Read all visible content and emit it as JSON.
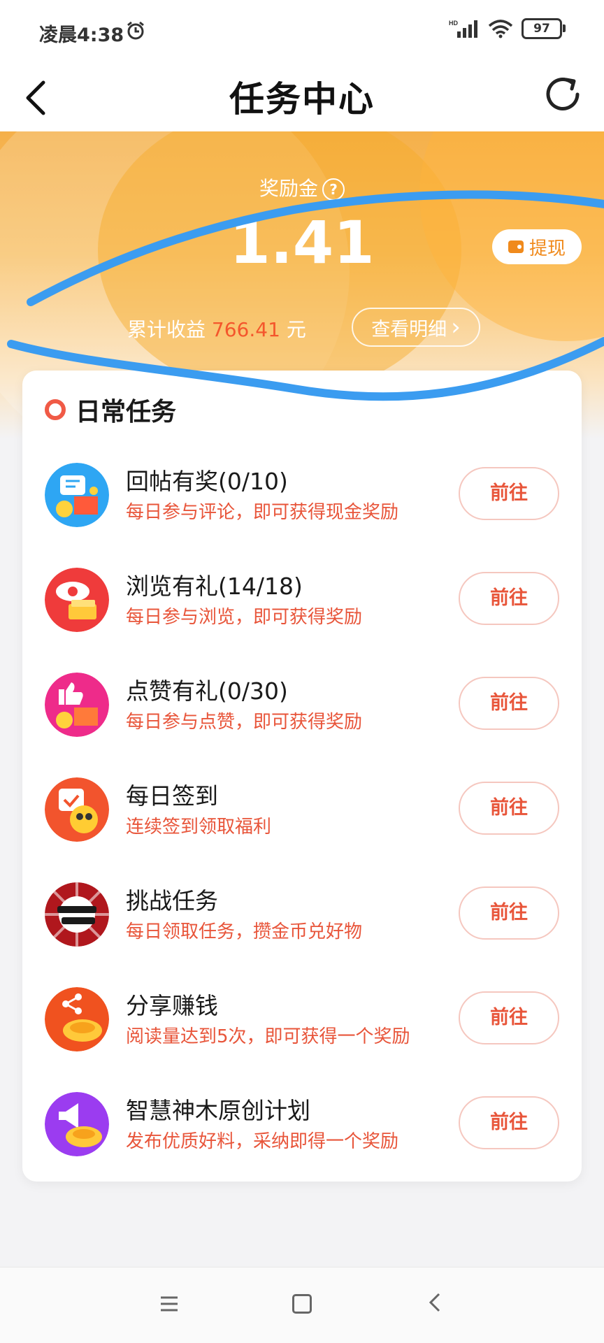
{
  "status_bar": {
    "time": "凌晨4:38",
    "network": "HD",
    "battery": "97"
  },
  "header": {
    "title": "任务中心"
  },
  "wallet": {
    "label": "奖励金",
    "help": "?",
    "amount": "1.41",
    "withdraw_label": "提现",
    "total_prefix": "累计收益",
    "total_value": "766.41",
    "total_unit": "元",
    "detail_label": "查看明细",
    "detail_arrow": "›"
  },
  "daily_tasks": {
    "title": "日常任务",
    "items": [
      {
        "name": "回帖有奖(0/10)",
        "desc": "每日参与评论，即可获得现金奖励",
        "button": "前往",
        "icon": "comment-reward-icon",
        "color": "#2ea6f3"
      },
      {
        "name": "浏览有礼(14/18)",
        "desc": "每日参与浏览，即可获得奖励",
        "button": "前往",
        "icon": "eye-reward-icon",
        "color": "#ef3b3b"
      },
      {
        "name": "点赞有礼(0/30)",
        "desc": "每日参与点赞，即可获得奖励",
        "button": "前往",
        "icon": "like-reward-icon",
        "color": "#ee2b8a"
      },
      {
        "name": "每日签到",
        "desc": "连续签到领取福利",
        "button": "前往",
        "icon": "checkin-calendar-icon",
        "color": "#f2542d"
      },
      {
        "name": "挑战任务",
        "desc": "每日领取任务，攒金币兑好物",
        "button": "前往",
        "icon": "challenge-task-icon",
        "color": "#b0171d"
      },
      {
        "name": "分享赚钱",
        "desc": "阅读量达到5次，即可获得一个奖励",
        "button": "前往",
        "icon": "share-money-icon",
        "color": "#f0521f"
      },
      {
        "name": "智慧神木原创计划",
        "desc": "发布优质好料，采纳即得一个奖励",
        "button": "前往",
        "icon": "megaphone-reward-icon",
        "color": "#9b3cf0"
      }
    ]
  },
  "colors": {
    "accent": "#e8553a",
    "hero_orange": "#f5b04a",
    "annotation_blue": "#3b9cf0"
  }
}
